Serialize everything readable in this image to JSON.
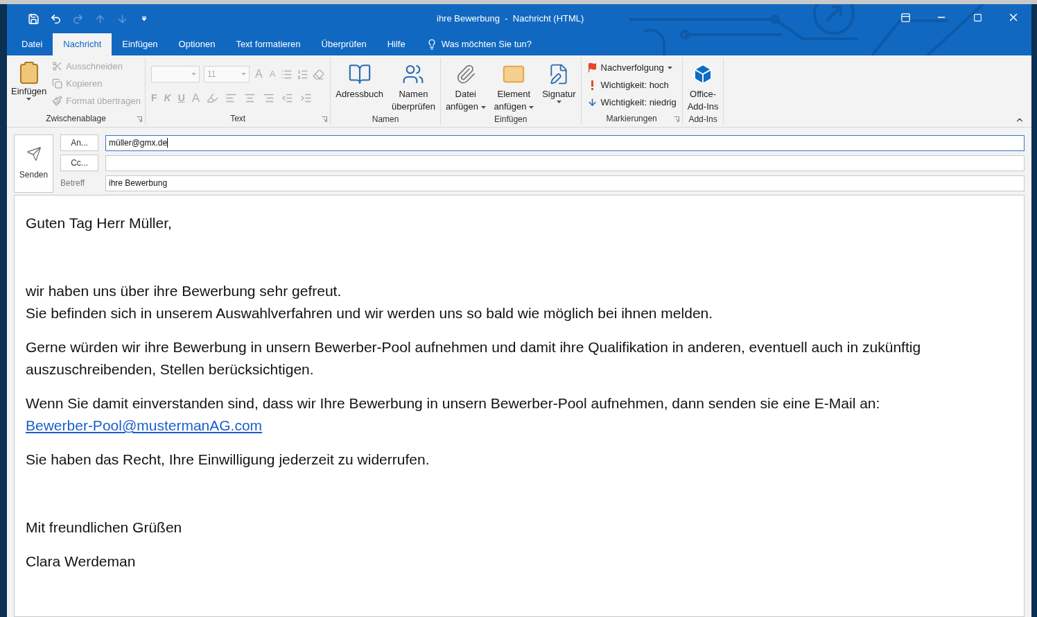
{
  "window": {
    "title": "ihre Bewerbung  -  Nachricht (HTML)"
  },
  "quick_access": [
    {
      "kind": "save",
      "disabled": false
    },
    {
      "kind": "undo",
      "disabled": false
    },
    {
      "kind": "redo",
      "disabled": true
    },
    {
      "kind": "up",
      "disabled": true
    },
    {
      "kind": "down",
      "disabled": true
    },
    {
      "kind": "customize",
      "disabled": false
    }
  ],
  "tabs": [
    {
      "label": "Datei",
      "selected": false
    },
    {
      "label": "Nachricht",
      "selected": true
    },
    {
      "label": "Einfügen",
      "selected": false
    },
    {
      "label": "Optionen",
      "selected": false
    },
    {
      "label": "Text formatieren",
      "selected": false
    },
    {
      "label": "Überprüfen",
      "selected": false
    },
    {
      "label": "Hilfe",
      "selected": false
    }
  ],
  "tell_me": {
    "placeholder": "Was möchten Sie tun?"
  },
  "ribbon": {
    "groups": [
      {
        "kind": "clipboard",
        "label": "Zwischenablage",
        "launcher": true,
        "paste": {
          "label": "Einfügen"
        },
        "items": [
          {
            "kind": "cut",
            "label": "Ausschneiden",
            "disabled": true
          },
          {
            "kind": "copy",
            "label": "Kopieren",
            "disabled": true
          },
          {
            "kind": "painter",
            "label": "Format übertragen",
            "disabled": true
          }
        ]
      },
      {
        "kind": "text",
        "label": "Text",
        "launcher": true,
        "font_size": {
          "value": "11",
          "disabled": true
        },
        "size_buttons": [
          {
            "kind": "grow",
            "label": "A",
            "disabled": true
          },
          {
            "kind": "shrink",
            "label": "A",
            "disabled": true
          }
        ],
        "format_buttons": [
          {
            "kind": "bold",
            "label": "F",
            "disabled": true
          },
          {
            "kind": "italic",
            "label": "K",
            "disabled": true
          },
          {
            "kind": "underline",
            "label": "U",
            "disabled": true
          },
          {
            "kind": "color",
            "label": "A",
            "disabled": true
          }
        ]
      },
      {
        "kind": "large",
        "label": "Namen",
        "launcher": false,
        "buttons": [
          {
            "kind": "addressbook",
            "label": "Adressbuch",
            "dropdown": false
          },
          {
            "kind": "checknames",
            "label": "Namen\nüberprüfen",
            "dropdown": false
          }
        ]
      },
      {
        "kind": "large",
        "label": "Einfügen",
        "launcher": false,
        "buttons": [
          {
            "kind": "attachfile",
            "label": "Datei\nanfügen",
            "dropdown": true
          },
          {
            "kind": "attachitem",
            "label": "Element\nanfügen",
            "dropdown": true
          },
          {
            "kind": "signature",
            "label": "Signatur",
            "dropdown": true
          }
        ]
      },
      {
        "kind": "small",
        "label": "Markierungen",
        "launcher": true,
        "items": [
          {
            "kind": "flag",
            "label": "Nachverfolgung",
            "dropdown": true
          },
          {
            "kind": "high",
            "label": "Wichtigkeit: hoch",
            "dropdown": false
          },
          {
            "kind": "low",
            "label": "Wichtigkeit: niedrig",
            "dropdown": false
          }
        ]
      },
      {
        "kind": "large",
        "label": "Add-Ins",
        "launcher": false,
        "buttons": [
          {
            "kind": "addins",
            "label": "Office-\nAdd-Ins",
            "dropdown": false
          }
        ]
      }
    ]
  },
  "compose": {
    "send": {
      "label": "Senden"
    },
    "fields": [
      {
        "kind": "button",
        "label": "An...",
        "value": "müller@gmx.de",
        "focused": true
      },
      {
        "kind": "button",
        "label": "Cc...",
        "focused": false
      },
      {
        "kind": "label",
        "label": "Betreff",
        "value": "ihre Bewerbung",
        "focused": false
      }
    ]
  },
  "body": [
    {
      "kind": "text",
      "lines": [
        "Guten Tag Herr Müller,"
      ]
    },
    {
      "kind": "blank"
    },
    {
      "kind": "text",
      "lines": [
        "wir haben uns über ihre Bewerbung sehr gefreut.",
        "Sie befinden sich in unserem Auswahlverfahren und wir werden uns so bald wie möglich bei ihnen melden."
      ]
    },
    {
      "kind": "text",
      "lines": [
        "Gerne würden wir ihre Bewerbung in unsern Bewerber-Pool aufnehmen und damit ihre Qualifikation in anderen, eventuell auch in zukünftig auszuschreibenden, Stellen berücksichtigen."
      ]
    },
    {
      "kind": "text",
      "lines": [
        "Wenn Sie damit einverstanden sind, dass wir Ihre Bewerbung in unsern Bewerber-Pool aufnehmen, dann senden sie eine E-Mail an:"
      ],
      "link": "Bewerber-Pool@mustermanAG.com"
    },
    {
      "kind": "text",
      "lines": [
        "Sie haben das Recht, Ihre Einwilligung jederzeit zu widerrufen."
      ]
    },
    {
      "kind": "blank"
    },
    {
      "kind": "text",
      "lines": [
        "Mit freundlichen Grüßen"
      ]
    },
    {
      "kind": "text",
      "lines": [
        "Clara Werdeman"
      ]
    }
  ]
}
